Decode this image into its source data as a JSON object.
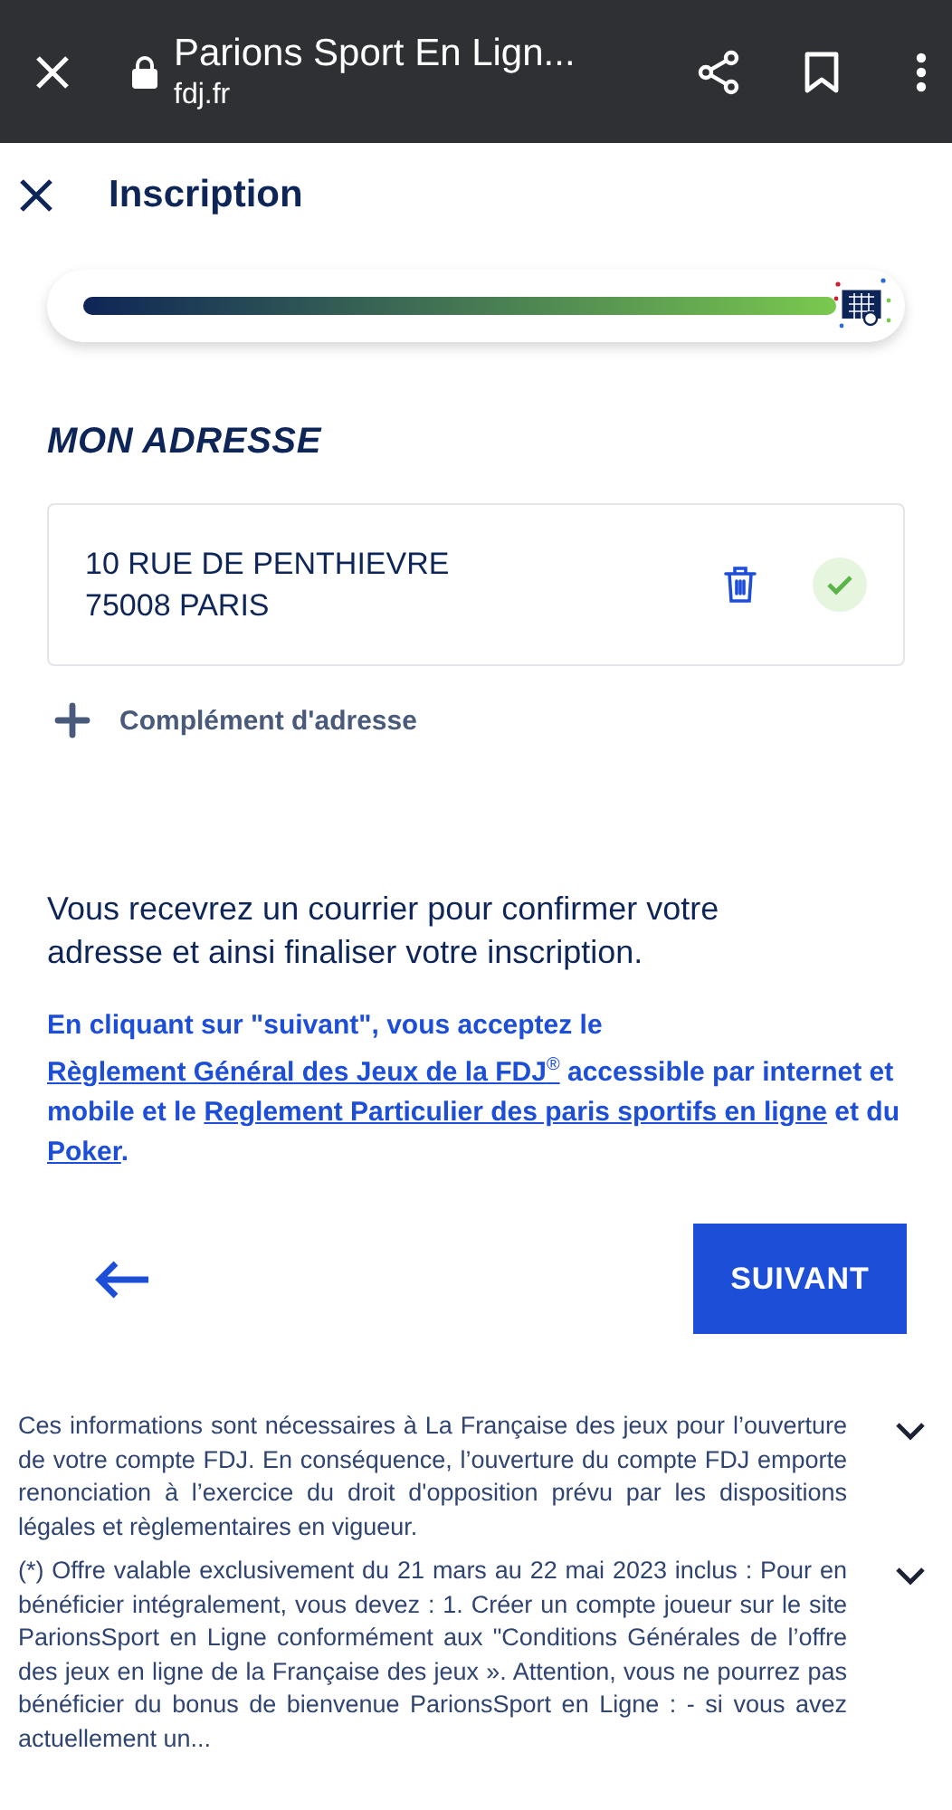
{
  "browser": {
    "title": "Parions Sport En Lign...",
    "domain": "fdj.fr"
  },
  "header": {
    "title": "Inscription"
  },
  "progress": {
    "level": 1
  },
  "section_title": "MON ADRESSE",
  "address": {
    "lines": [
      "10 RUE DE PENTHIEVRE",
      "75008 PARIS"
    ],
    "validated": true
  },
  "add_complement": {
    "label": "Complément d'adresse"
  },
  "info": "Vous recevrez un courrier pour confirmer votre adresse et ainsi finaliser votre inscription.",
  "legal": [
    {
      "text": "En cliquant sur \"suivant\", vous acceptez le ",
      "link": false
    },
    {
      "text": "Règlement Général des Jeux de la FDJ$^{®}$",
      "link": true
    },
    {
      "text": " accessible par internet et mobile et le ",
      "link": false
    },
    {
      "text": "Reglement Particulier des paris sportifs en ligne",
      "link": true
    },
    {
      "text": " et du ",
      "link": false
    },
    {
      "text": "Poker",
      "link": true
    },
    {
      "text": ".",
      "link": false
    }
  ],
  "next_button": {
    "label": "SUIVANT"
  },
  "footnotes": [
    {
      "text": "Ces informations sont nécessaires à La Française des jeux pour l’ouverture de votre compte FDJ. En conséquence, l’ouverture du compte FDJ emporte renonciation à l’exercice du droit d'opposition prévu par les dispositions légales et règlementaires en vigueur.",
      "expanded": false
    },
    {
      "text": "(*) Offre valable exclusivement du 21 mars au 22 mai 2023 inclus : Pour en bénéficier intégralement, vous devez : 1. Créer un compte joueur sur le site ParionsSport en Ligne conformément aux \"Conditions Générales de l’offre des jeux en ligne de la Française des jeux ». Attention, vous ne pourrez pas bénéficier du bonus de bienvenue ParionsSport en Ligne : - si vous avez actuellement un...",
      "expanded": false
    }
  ]
}
